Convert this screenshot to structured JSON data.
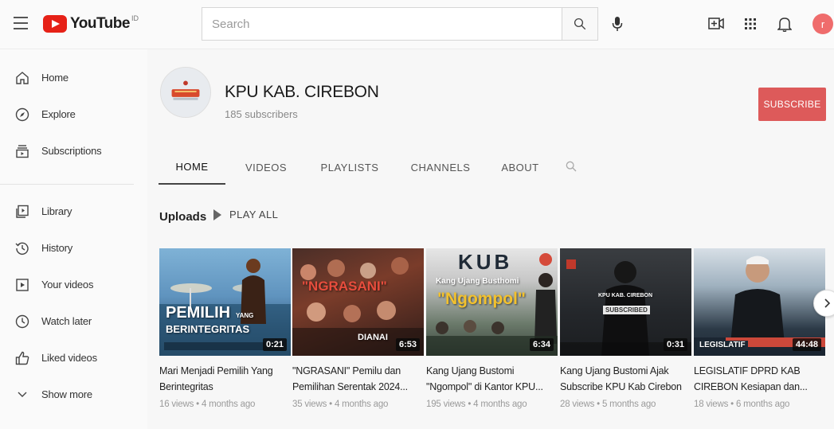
{
  "header": {
    "logo_text": "YouTube",
    "logo_reg": "ID",
    "search_placeholder": "Search",
    "avatar_letter": "r",
    "icons": [
      "menu-icon",
      "search-icon",
      "mic-icon",
      "create-video-icon",
      "apps-icon",
      "bell-icon"
    ]
  },
  "sidebar": {
    "items": [
      {
        "label": "Home",
        "icon": "home-icon"
      },
      {
        "label": "Explore",
        "icon": "compass-icon"
      },
      {
        "label": "Subscriptions",
        "icon": "subscriptions-icon"
      },
      {
        "label": "Library",
        "icon": "library-icon"
      },
      {
        "label": "History",
        "icon": "history-icon"
      },
      {
        "label": "Your videos",
        "icon": "your-videos-icon"
      },
      {
        "label": "Watch later",
        "icon": "clock-icon"
      },
      {
        "label": "Liked videos",
        "icon": "thumbs-up-icon"
      },
      {
        "label": "Show more",
        "icon": "chevron-down-icon"
      }
    ]
  },
  "channel": {
    "name": "KPU KAB. CIREBON",
    "subscribers": "185 subscribers",
    "subscribe_label": "SUBSCRIBE",
    "subscribe_color": "#dd5a5a"
  },
  "tabs": [
    {
      "label": "HOME",
      "active": true
    },
    {
      "label": "VIDEOS",
      "active": false
    },
    {
      "label": "PLAYLISTS",
      "active": false
    },
    {
      "label": "CHANNELS",
      "active": false
    },
    {
      "label": "ABOUT",
      "active": false
    }
  ],
  "uploads": {
    "label": "Uploads",
    "play_all_label": "PLAY ALL",
    "videos": [
      {
        "title": "Mari Menjadi Pemilih Yang Berintegritas",
        "meta": "16 views • 4 months ago",
        "duration": "0:21",
        "thumb_text_main": "PEMILIH",
        "thumb_text_small": "YANG",
        "thumb_text_sub": "BERINTEGRITAS"
      },
      {
        "title": "\"NGRASANI\" Pemilu dan Pemilihan Serentak 2024...",
        "meta": "35 views • 4 months ago",
        "duration": "6:53",
        "thumb_text_main": "\"NGRASANI\"",
        "thumb_text_sub": "DIANAI"
      },
      {
        "title": "Kang Ujang Bustomi \"Ngompol\" di Kantor KPU...",
        "meta": "195 views • 4 months ago",
        "duration": "6:34",
        "thumb_text_main": "KUB",
        "thumb_text_small": "Kang Ujang Busthomi",
        "thumb_text_sub": "\"Ngompol\""
      },
      {
        "title": "Kang Ujang Bustomi Ajak Subscribe KPU Kab Cirebon",
        "meta": "28 views • 5 months ago",
        "duration": "0:31",
        "thumb_text_main": "KPU KAB. CIREBON",
        "thumb_text_sub": "SUBSCRIBED"
      },
      {
        "title": "LEGISLATIF DPRD KAB CIREBON Kesiapan dan...",
        "meta": "18 views • 6 months ago",
        "duration": "44:48",
        "thumb_text_main": "LEGISLATIF"
      }
    ]
  }
}
